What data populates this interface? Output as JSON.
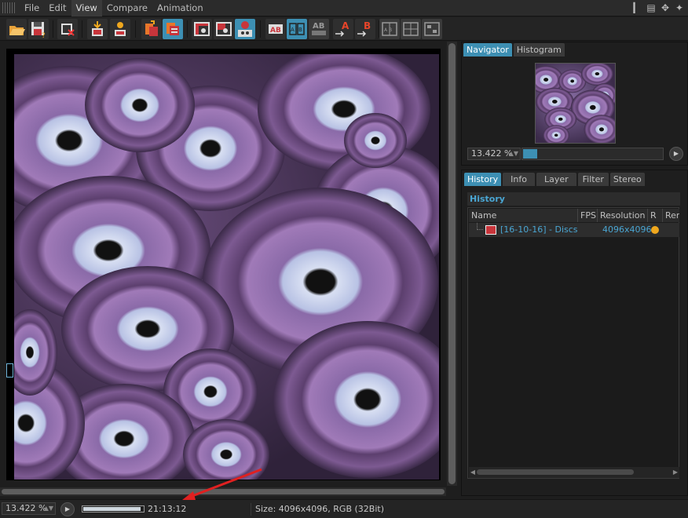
{
  "menu": {
    "items": [
      "File",
      "Edit",
      "View",
      "Compare",
      "Animation"
    ],
    "active": "View"
  },
  "toolbar": {
    "buttons": [
      {
        "name": "open-file-icon"
      },
      {
        "name": "save-as-icon"
      },
      {
        "name": "clear-icon"
      },
      {
        "name": "import-icon"
      },
      {
        "name": "export-icon"
      },
      {
        "name": "copy-layer-icon"
      },
      {
        "name": "paste-layer-icon"
      },
      {
        "name": "view-a-icon"
      },
      {
        "name": "view-b-icon"
      },
      {
        "name": "view-ab-icon"
      },
      {
        "name": "ab-split-icon"
      },
      {
        "name": "ab-side-icon"
      },
      {
        "name": "ab-stack-icon"
      },
      {
        "name": "set-a-icon"
      },
      {
        "name": "set-b-icon"
      },
      {
        "name": "mode-1-icon"
      },
      {
        "name": "mode-2-icon"
      },
      {
        "name": "mode-3-icon"
      }
    ],
    "labels": {
      "set_a": "A",
      "set_b": "B",
      "view_a": "A",
      "view_b": "B",
      "ab": "AB"
    }
  },
  "navigator": {
    "tabs": [
      "Navigator",
      "Histogram"
    ],
    "active_tab": "Navigator",
    "zoom_value": "13.422 %"
  },
  "history_panel": {
    "tabs": [
      "History",
      "Info",
      "Layer",
      "Filter",
      "Stereo"
    ],
    "active_tab": "History",
    "title": "History",
    "columns": [
      "Name",
      "FPS",
      "Resolution",
      "R",
      "Ren"
    ],
    "rows": [
      {
        "name": "[16-10-16] - Discs",
        "fps": "",
        "resolution": "4096x4096",
        "status_color": "#f0a81e"
      }
    ]
  },
  "statusbar": {
    "zoom_value": "13.422 %",
    "progress": 0.96,
    "time": "21:13:12",
    "info": "Size: 4096x4096, RGB (32Bit)"
  },
  "colors": {
    "accent": "#3d8fb3",
    "link": "#4aa6d3",
    "annotation_arrow": "#e02020"
  }
}
